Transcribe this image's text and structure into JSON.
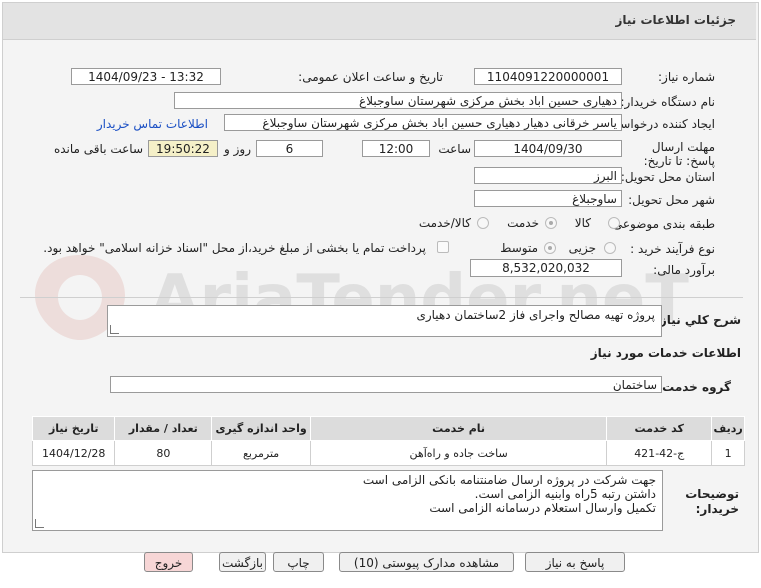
{
  "header": {
    "title": "جزئیات اطلاعات نیاز"
  },
  "labels": {
    "need_number": "شماره نیاز:",
    "announce_datetime": "تاریخ و ساعت اعلان عمومی:",
    "buyer_org": "نام دستگاه خریدار:",
    "requester": "ایجاد کننده درخواست:",
    "contact_link": "اطلاعات تماس خریدار",
    "deadline": "مهلت ارسال پاسخ: تا تاریخ:",
    "time_word": "ساعت",
    "days_and": "روز و",
    "remaining": "ساعت باقی مانده",
    "province": "استان محل تحویل:",
    "city": "شهر محل تحویل:",
    "category": "طبقه بندی موضوعی:",
    "cat_goods": "کالا",
    "cat_service": "خدمت",
    "cat_goods_service": "کالا/خدمت",
    "purchase_type": "نوع فرآیند خرید :",
    "pt_small": "جزیی",
    "pt_medium": "متوسط",
    "payment_note": "پرداخت تمام یا بخشی از مبلغ خرید،از محل \"اسناد خزانه اسلامی\" خواهد بود.",
    "estimate": "برآورد مالی:",
    "description": "شرح کلي نياز:",
    "services_info": "اطلاعات خدمات مورد نیاز",
    "service_group": "گروه خدمت:",
    "buyer_notes": "توضیحات خریدار:"
  },
  "values": {
    "need_number": "1104091220000001",
    "announce_datetime": "1404/09/23 - 13:32",
    "buyer_org": "دهیاری حسین اباد بخش مرکزی شهرستان ساوجبلاغ",
    "requester": "یاسر خرقانی دهیار دهیاری حسین اباد بخش مرکزی شهرستان ساوجبلاغ",
    "deadline_date": "1404/09/30",
    "deadline_time": "12:00",
    "days": "6",
    "remaining_time": "19:50:22",
    "province": "البرز",
    "city": "ساوجبلاغ",
    "estimate": "8,532,020,032",
    "description": "پروژه تهیه مصالح واجرای فاز 2ساختمان دهیاری",
    "service_group": "ساختمان",
    "notes_line1": "جهت شرکت در پروژه ارسال  ضامنتنامه بانکی الزامی است",
    "notes_line2": "داشتن رتبه 5راه وابنیه الزامی است.",
    "notes_line3": "تکمیل وارسال استعلام درسامانه الزامی است"
  },
  "table": {
    "headers": [
      "ردیف",
      "کد خدمت",
      "نام خدمت",
      "واحد اندازه گیری",
      "تعداد / مقدار",
      "تاریخ نیاز"
    ],
    "rows": [
      [
        "1",
        "ج-42-421",
        "ساخت جاده و راه‌آهن",
        "مترمربع",
        "80",
        "1404/12/28"
      ]
    ]
  },
  "buttons": {
    "reply": "پاسخ به نیاز",
    "attachments": "مشاهده مدارک پیوستی (10)",
    "print": "چاپ",
    "back": "بازگشت",
    "exit": "خروج"
  },
  "watermark_text": "AriaTender.neT",
  "colors": {
    "link": "#1a4fc4",
    "highlight_box": "#f5f0c8",
    "exit_bg": "#f7d6d6"
  }
}
